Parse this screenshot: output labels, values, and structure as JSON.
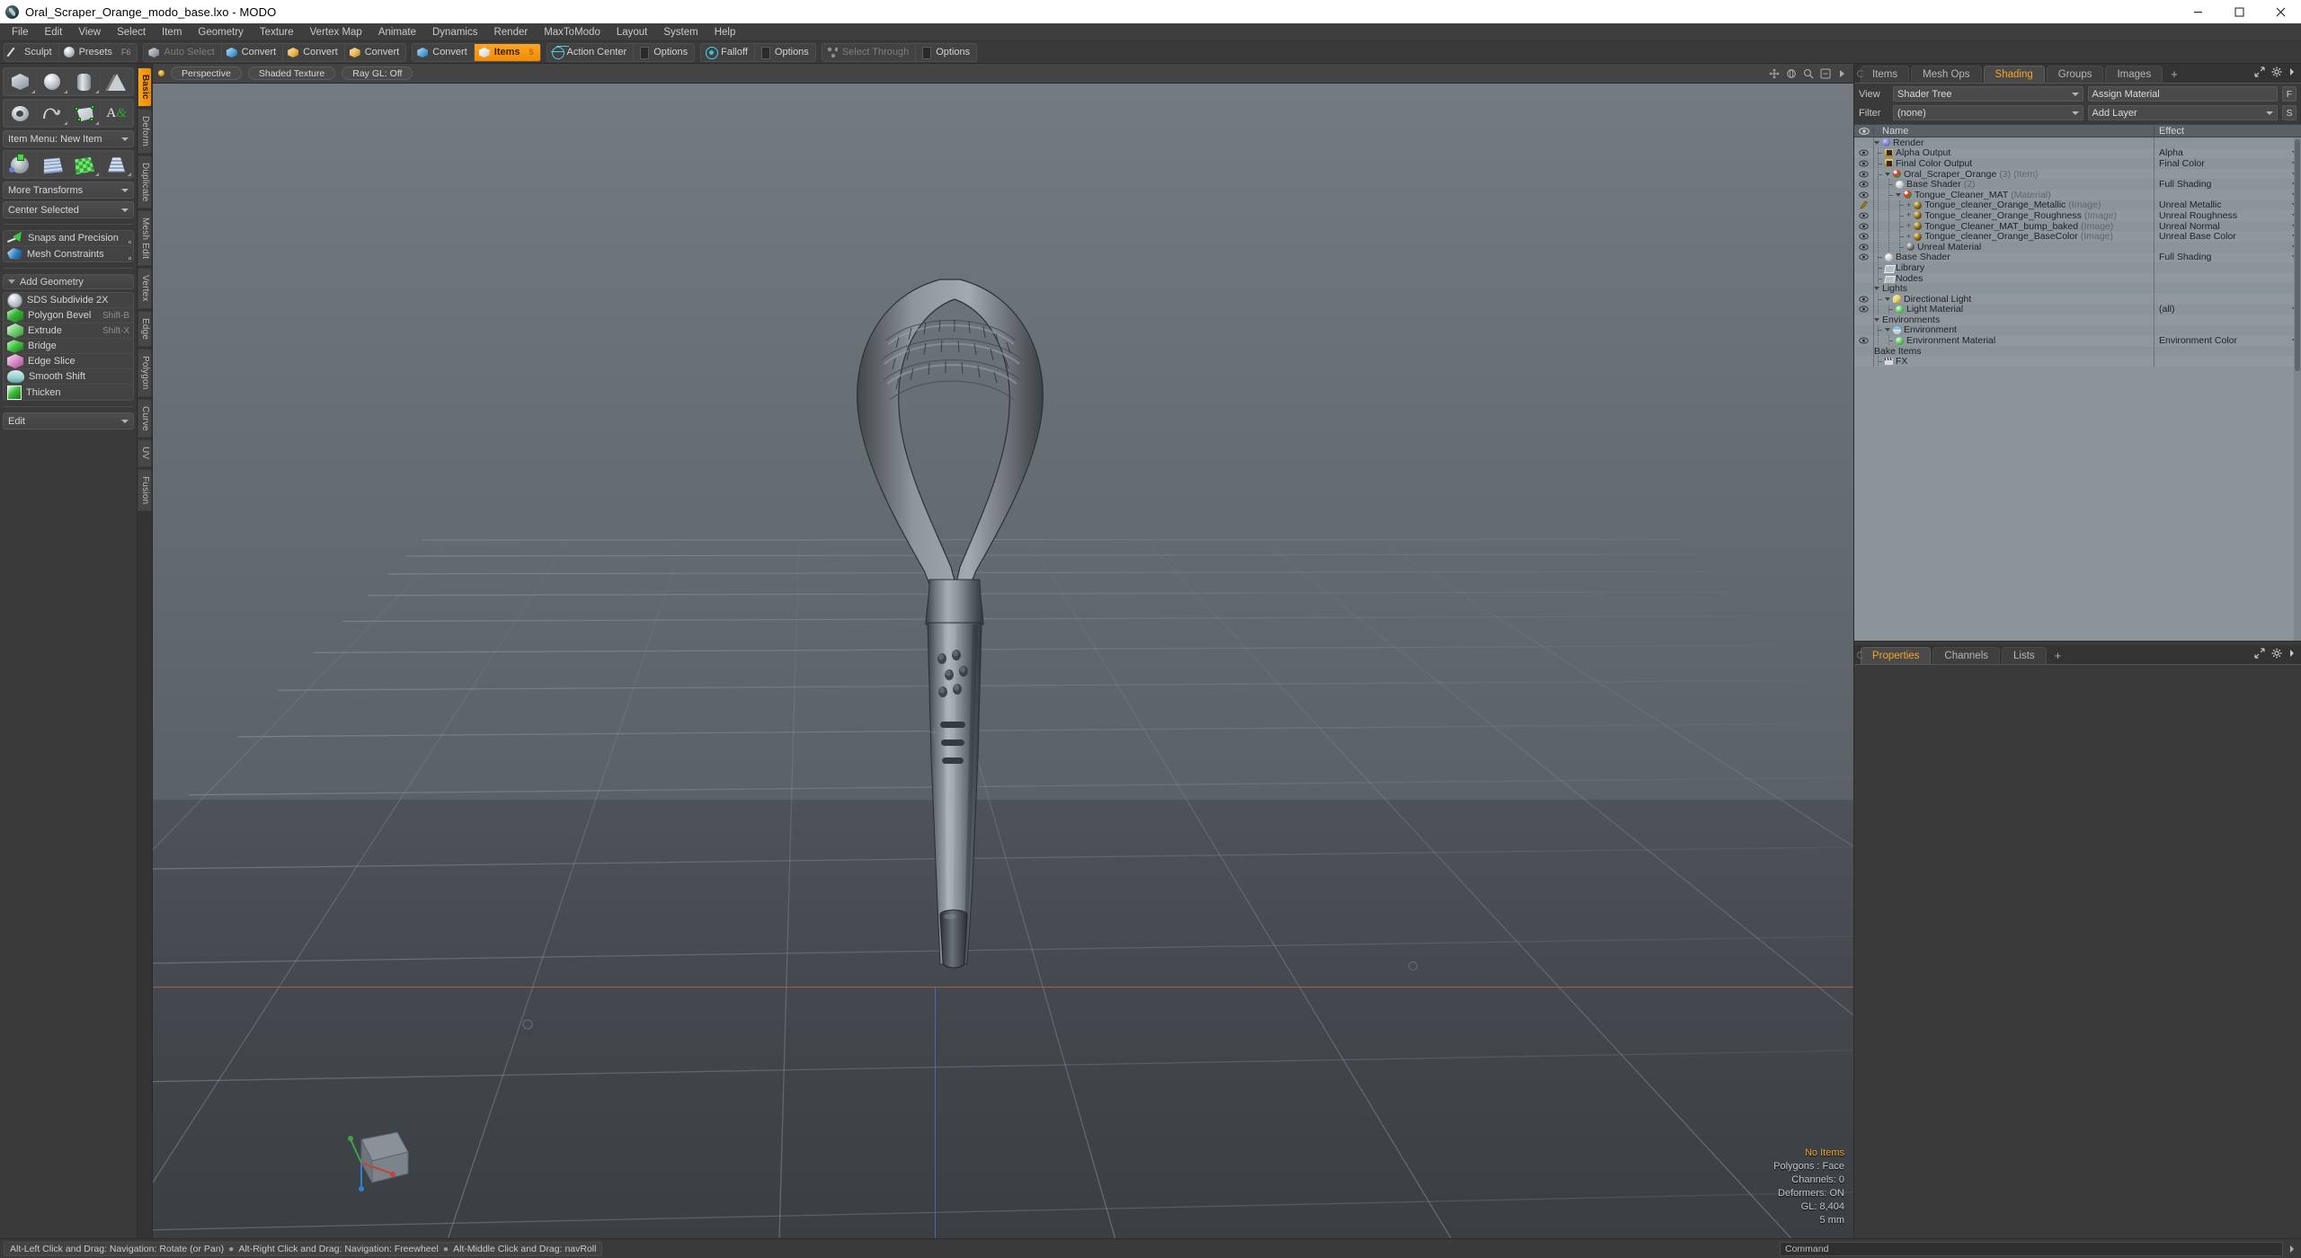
{
  "window": {
    "title": "Oral_Scraper_Orange_modo_base.lxo - MODO",
    "logo_icon": "modo-logo-icon",
    "controls": [
      {
        "name": "minimize-button",
        "icon": "minimize-icon"
      },
      {
        "name": "maximize-button",
        "icon": "maximize-icon"
      },
      {
        "name": "close-button",
        "icon": "close-icon"
      }
    ]
  },
  "menubar": {
    "items": [
      "File",
      "Edit",
      "View",
      "Select",
      "Item",
      "Geometry",
      "Texture",
      "Vertex Map",
      "Animate",
      "Dynamics",
      "Render",
      "MaxToModo",
      "Layout",
      "System",
      "Help"
    ]
  },
  "toolbar": {
    "groups": [
      {
        "name": "mode-group",
        "buttons": [
          {
            "label": "Sculpt",
            "icon": "pen-icon",
            "state": "normal",
            "hotkey": ""
          },
          {
            "label": "Presets",
            "icon": "sphere-icon",
            "state": "normal",
            "hotkey": "F6"
          }
        ]
      },
      {
        "name": "selection-group",
        "buttons": [
          {
            "label": "Auto Select",
            "icon": "cube-gray-icon",
            "state": "disabled",
            "hotkey": ""
          },
          {
            "label": "Convert",
            "icon": "cube-blue-icon",
            "state": "normal",
            "hotkey": ""
          },
          {
            "label": "Convert",
            "icon": "cube-yellow-icon",
            "state": "normal",
            "hotkey": ""
          },
          {
            "label": "Convert",
            "icon": "cube-tan-icon",
            "state": "normal",
            "hotkey": ""
          }
        ]
      },
      {
        "name": "item-mode-group",
        "buttons": [
          {
            "label": "Convert",
            "icon": "cube-blue-icon",
            "state": "normal",
            "hotkey": ""
          },
          {
            "label": "Items",
            "icon": "cube-orange-icon",
            "state": "active",
            "hotkey": "5"
          }
        ]
      },
      {
        "name": "action-center-group",
        "buttons": [
          {
            "label": "Action Center",
            "icon": "target-icon",
            "state": "normal",
            "hotkey": ""
          },
          {
            "label": "Options",
            "icon": "options-icon",
            "state": "normal",
            "hotkey": ""
          }
        ]
      },
      {
        "name": "falloff-group",
        "buttons": [
          {
            "label": "Falloff",
            "icon": "falloff-icon",
            "state": "normal",
            "hotkey": ""
          },
          {
            "label": "Options",
            "icon": "options-icon",
            "state": "normal",
            "hotkey": ""
          }
        ]
      },
      {
        "name": "select-through-group",
        "buttons": [
          {
            "label": "Select Through",
            "icon": "select-through-icon",
            "state": "disabled",
            "hotkey": ""
          },
          {
            "label": "Options",
            "icon": "options-icon",
            "state": "normal",
            "hotkey": ""
          }
        ]
      }
    ]
  },
  "left_panel": {
    "primitives_row1": [
      {
        "name": "cube-primitive",
        "icon": "cube-icon"
      },
      {
        "name": "sphere-primitive",
        "icon": "sphere-icon"
      },
      {
        "name": "cylinder-primitive",
        "icon": "cylinder-icon"
      },
      {
        "name": "cone-primitive",
        "icon": "cone-icon"
      }
    ],
    "primitives_row2": [
      {
        "name": "torus-primitive",
        "icon": "torus-icon"
      },
      {
        "name": "curve-tool",
        "icon": "curve-icon"
      },
      {
        "name": "polygon-tool",
        "icon": "polygon-vertex-icon"
      },
      {
        "name": "text-tool",
        "icon": "text-icon"
      }
    ],
    "item_menu": "Item Menu: New Item",
    "transform_row": [
      {
        "name": "transform-gizmo-tool",
        "icon": "axis-gizmo-icon"
      },
      {
        "name": "bend-tool",
        "icon": "mesh-grid-icon"
      },
      {
        "name": "shear-tool",
        "icon": "green-checker-icon"
      },
      {
        "name": "taper-tool",
        "icon": "taper-grid-icon"
      }
    ],
    "more_transforms": "More Transforms",
    "center_selected": "Center Selected",
    "snaps": "Snaps and Precision",
    "mesh_constraints": "Mesh Constraints",
    "add_geometry_header": "Add Geometry",
    "geometry_items": [
      {
        "label": "SDS Subdivide 2X",
        "shortcut": "",
        "icon": "sds-subdivide-icon"
      },
      {
        "label": "Polygon Bevel",
        "shortcut": "Shift-B",
        "icon": "bevel-icon"
      },
      {
        "label": "Extrude",
        "shortcut": "Shift-X",
        "icon": "extrude-icon"
      },
      {
        "label": "Bridge",
        "shortcut": "",
        "icon": "bridge-icon"
      },
      {
        "label": "Edge Slice",
        "shortcut": "",
        "icon": "edge-slice-icon"
      },
      {
        "label": "Smooth Shift",
        "shortcut": "",
        "icon": "smooth-shift-icon"
      },
      {
        "label": "Thicken",
        "shortcut": "",
        "icon": "thicken-icon"
      }
    ],
    "edit_dropdown": "Edit",
    "vertical_tabs": [
      {
        "label": "Basic",
        "active": true
      },
      {
        "label": "Deform",
        "active": false
      },
      {
        "label": "Duplicate",
        "active": false
      },
      {
        "label": "Mesh Edit",
        "active": false
      },
      {
        "label": "Vertex",
        "active": false
      },
      {
        "label": "Edge",
        "active": false
      },
      {
        "label": "Polygon",
        "active": false
      },
      {
        "label": "Curve",
        "active": false
      },
      {
        "label": "UV",
        "active": false
      },
      {
        "label": "Fusion",
        "active": false
      }
    ]
  },
  "viewport": {
    "header": {
      "view_mode": "Perspective",
      "shading_mode": "Shaded Texture",
      "raygl": "Ray GL: Off"
    },
    "hud": {
      "items_status": "No Items",
      "polygons": "Polygons : Face",
      "channels": "Channels: 0",
      "deformers": "Deformers: ON",
      "gl": "GL: 8,404",
      "scale": "5 mm"
    },
    "axis_colors": {
      "x": "#b5614e",
      "z": "#4a74c8",
      "y": "#3fa34d"
    }
  },
  "right_panel": {
    "tabs": [
      {
        "label": "Items",
        "active": false
      },
      {
        "label": "Mesh Ops",
        "active": false
      },
      {
        "label": "Shading",
        "active": true
      },
      {
        "label": "Groups",
        "active": false
      },
      {
        "label": "Images",
        "active": false
      }
    ],
    "tab_add": "+",
    "view_label": "View",
    "view_value": "Shader Tree",
    "assign_material": "Assign Material",
    "assign_btn": "F",
    "filter_label": "Filter",
    "filter_value": "(none)",
    "add_layer": "Add Layer",
    "add_layer_btn": "S",
    "tree_headers": {
      "name": "Name",
      "effect": "Effect"
    },
    "tree_rows": [
      {
        "eye": "none",
        "indent": 0,
        "twist": "open",
        "icon": "render-icon",
        "label": "Render",
        "suffix": "",
        "effect": "",
        "caret": false
      },
      {
        "eye": "on",
        "indent": 1,
        "twist": "none",
        "icon": "output-icon",
        "label": "Alpha Output",
        "suffix": "",
        "effect": "Alpha",
        "caret": true
      },
      {
        "eye": "on",
        "indent": 1,
        "twist": "none",
        "icon": "output-icon",
        "label": "Final Color Output",
        "suffix": "",
        "effect": "Final Color",
        "caret": true
      },
      {
        "eye": "on",
        "indent": 1,
        "twist": "open",
        "icon": "material-ball-icon",
        "label": "Oral_Scraper_Orange",
        "suffix": "(3) (Item)",
        "effect": "",
        "caret": true
      },
      {
        "eye": "on",
        "indent": 2,
        "twist": "none",
        "icon": "gray-ball-icon",
        "label": "Base Shader",
        "suffix": "(2)",
        "effect": "Full Shading",
        "caret": true
      },
      {
        "eye": "on",
        "indent": 2,
        "twist": "open",
        "icon": "material-ball-icon",
        "label": "Tongue_Cleaner_MAT",
        "suffix": "(Material)",
        "effect": "",
        "caret": true
      },
      {
        "eye": "brush",
        "indent": 3,
        "twist": "plus",
        "icon": "image-ball-icon",
        "label": "Tongue_cleaner_Orange_Metallic",
        "suffix": "(Image)",
        "effect": "Unreal Metallic",
        "caret": true
      },
      {
        "eye": "on",
        "indent": 3,
        "twist": "plus",
        "icon": "image-ball-icon",
        "label": "Tongue_cleaner_Orange_Roughness",
        "suffix": "(Image)",
        "effect": "Unreal Roughness",
        "caret": true
      },
      {
        "eye": "on",
        "indent": 3,
        "twist": "plus",
        "icon": "image-ball-icon",
        "label": "Tongue_Cleaner_MAT_bump_baked",
        "suffix": "(Image)",
        "effect": "Unreal Normal",
        "caret": true
      },
      {
        "eye": "on",
        "indent": 3,
        "twist": "plus",
        "icon": "image-ball-icon",
        "label": "Tongue_cleaner_Orange_BaseColor",
        "suffix": "(Image)",
        "effect": "Unreal Base Color",
        "caret": true
      },
      {
        "eye": "on",
        "indent": 3,
        "twist": "none",
        "icon": "unreal-ball-icon",
        "label": "Unreal Material",
        "suffix": "",
        "effect": "",
        "caret": true
      },
      {
        "eye": "on",
        "indent": 1,
        "twist": "none",
        "icon": "gray-ball-icon",
        "label": "Base Shader",
        "suffix": "",
        "effect": "Full Shading",
        "caret": true
      },
      {
        "eye": "none",
        "indent": 1,
        "twist": "none",
        "icon": "folder-icon",
        "label": "Library",
        "suffix": "",
        "effect": "",
        "caret": false
      },
      {
        "eye": "none",
        "indent": 1,
        "twist": "none",
        "icon": "folder-icon",
        "label": "Nodes",
        "suffix": "",
        "effect": "",
        "caret": false
      },
      {
        "eye": "none",
        "indent": 0,
        "twist": "open",
        "icon": "none",
        "label": "Lights",
        "suffix": "",
        "effect": "",
        "caret": false
      },
      {
        "eye": "on",
        "indent": 1,
        "twist": "open",
        "icon": "light-icon",
        "label": "Directional Light",
        "suffix": "",
        "effect": "",
        "caret": false
      },
      {
        "eye": "on",
        "indent": 2,
        "twist": "none",
        "icon": "green-ball-icon",
        "label": "Light Material",
        "suffix": "",
        "effect": "(all)",
        "caret": true
      },
      {
        "eye": "none",
        "indent": 0,
        "twist": "open",
        "icon": "none",
        "label": "Environments",
        "suffix": "",
        "effect": "",
        "caret": false
      },
      {
        "eye": "none",
        "indent": 1,
        "twist": "open",
        "icon": "env-icon",
        "label": "Environment",
        "suffix": "",
        "effect": "",
        "caret": false
      },
      {
        "eye": "on",
        "indent": 2,
        "twist": "none",
        "icon": "green-ball-icon",
        "label": "Environment Material",
        "suffix": "",
        "effect": "Environment Color",
        "caret": true
      },
      {
        "eye": "none",
        "indent": 0,
        "twist": "none",
        "icon": "none",
        "label": "Bake Items",
        "suffix": "",
        "effect": "",
        "caret": false
      },
      {
        "eye": "none",
        "indent": 1,
        "twist": "none",
        "icon": "fx-icon",
        "label": "FX",
        "suffix": "",
        "effect": "",
        "caret": false
      }
    ],
    "props_tabs": [
      {
        "label": "Properties",
        "active": true
      },
      {
        "label": "Channels",
        "active": false
      },
      {
        "label": "Lists",
        "active": false
      }
    ],
    "props_tab_add": "+"
  },
  "statusbar": {
    "hint_1": "Alt-Left Click and Drag: Navigation: Rotate (or Pan)",
    "hint_2": "Alt-Right Click and Drag: Navigation: Freewheel",
    "hint_3": "Alt-Middle Click and Drag: navRoll",
    "command_placeholder": "Command"
  }
}
